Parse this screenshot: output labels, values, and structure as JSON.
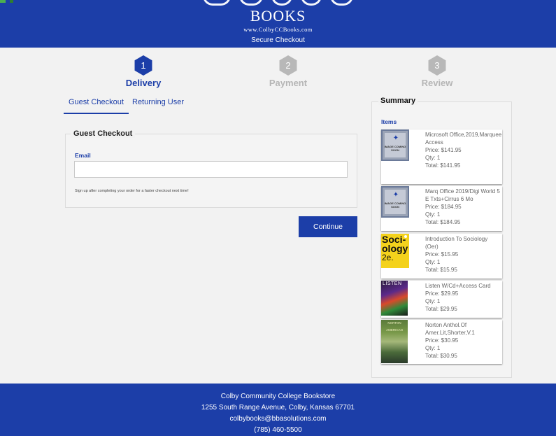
{
  "header": {
    "logo_text": "BOOKS",
    "website": "www.ColbyCCBooks.com",
    "subtitle": "Secure Checkout"
  },
  "steps": [
    {
      "number": "1",
      "label": "Delivery",
      "state": "active"
    },
    {
      "number": "2",
      "label": "Payment",
      "state": "inactive"
    },
    {
      "number": "3",
      "label": "Review",
      "state": "inactive"
    }
  ],
  "tabs": [
    {
      "label": "Guest Checkout",
      "active": true
    },
    {
      "label": "Returning User",
      "active": false
    }
  ],
  "guest_form": {
    "title": "Guest Checkout",
    "email_label": "Email",
    "email_value": "",
    "signup_note": "Sign up after completing your order for a faster checkout next time!",
    "continue_label": "Continue"
  },
  "summary": {
    "title": "Summary",
    "items_label": "Items",
    "placeholder_text": "IMAGE COMING SOON",
    "items": [
      {
        "name": "Microsoft Office,2019,Marquee Access",
        "price": "Price: $141.95",
        "qty": "Qty: 1",
        "total": "Total: $141.95",
        "cover": "placeholder"
      },
      {
        "name": "Marq Office 2019/Digi World 5 E Txts+Cirrus 6 Mo",
        "price": "Price: $184.95",
        "qty": "Qty: 1",
        "total": "Total: $184.95",
        "cover": "placeholder"
      },
      {
        "name": "Introduction To Sociology (Oer)",
        "price": "Price: $15.95",
        "qty": "Qty: 1",
        "total": "Total: $15.95",
        "cover": "sociology",
        "cover_text": [
          "Soci-",
          "ology",
          "2e."
        ]
      },
      {
        "name": "Listen W/Cd+Access Card",
        "price": "Price: $29.95",
        "qty": "Qty: 1",
        "total": "Total: $29.95",
        "cover": "listen",
        "cover_text": [
          "LISTEN"
        ]
      },
      {
        "name": "Norton Anthol.Of Amer.Lit,Shorter,V.1",
        "price": "Price: $30.95",
        "qty": "Qty: 1",
        "total": "Total: $30.95",
        "cover": "norton",
        "cover_text": [
          "NORTON",
          "AMERICAN"
        ]
      }
    ]
  },
  "footer": {
    "name": "Colby Community College Bookstore",
    "address": "1255 South Range Avenue, Colby, Kansas 67701",
    "email": "colbybooks@bbasolutions.com",
    "phone": "(785) 460-5500"
  },
  "colors": {
    "brand_blue": "#1c3ea8",
    "inactive_gray": "#b8b8b8",
    "page_bg": "#f2f2f2"
  }
}
